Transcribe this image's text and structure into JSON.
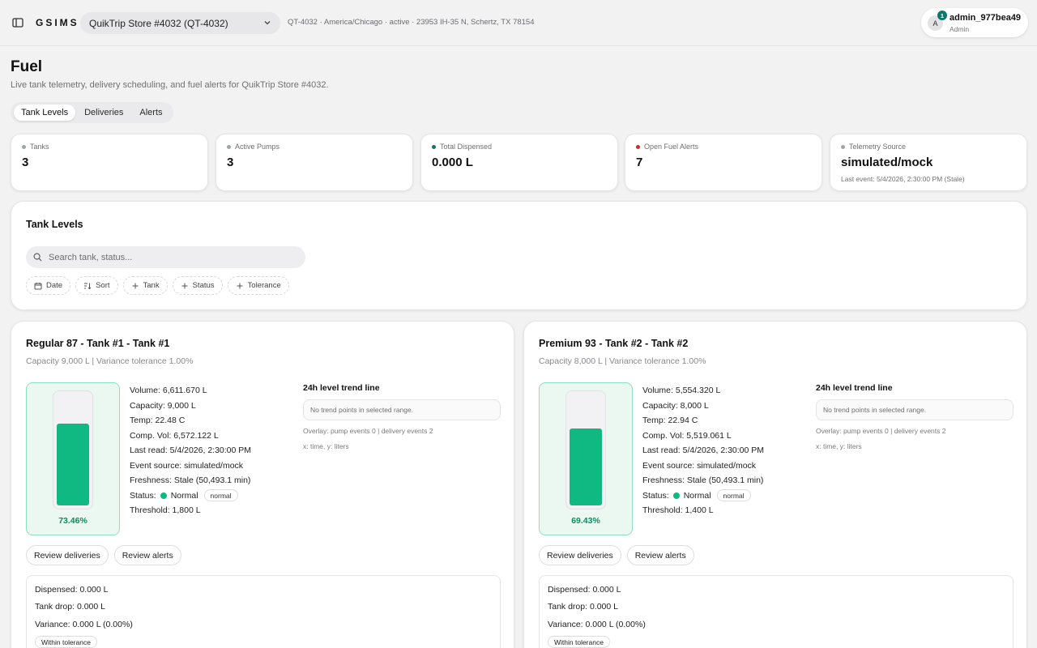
{
  "header": {
    "brand": "GSIMS",
    "store_select": "QuikTrip Store #4032 (QT-4032)",
    "store_meta": "QT-4032 · America/Chicago · active · 23953 IH-35 N, Schertz, TX 78154",
    "user": {
      "initial": "A",
      "badge": "1",
      "name": "admin_977bea49",
      "role": "Admin"
    }
  },
  "page": {
    "title": "Fuel",
    "subtitle": "Live tank telemetry, delivery scheduling, and fuel alerts for QuikTrip Store #4032."
  },
  "tabs": [
    "Tank Levels",
    "Deliveries",
    "Alerts"
  ],
  "stats": [
    {
      "label": "Tanks",
      "value": "3",
      "dot_color": "#9ca3af",
      "sub": ""
    },
    {
      "label": "Active Pumps",
      "value": "3",
      "dot_color": "#9ca3af",
      "sub": ""
    },
    {
      "label": "Total Dispensed",
      "value": "0.000 L",
      "dot_color": "#0f766e",
      "sub": ""
    },
    {
      "label": "Open Fuel Alerts",
      "value": "7",
      "dot_color": "#dc2626",
      "sub": ""
    },
    {
      "label": "Telemetry Source",
      "value": "simulated/mock",
      "dot_color": "#9ca3af",
      "sub": "Last event: 5/4/2026, 2:30:00 PM (Stale)"
    }
  ],
  "filter_panel": {
    "title": "Tank Levels",
    "search_placeholder": "Search tank, status...",
    "chips": [
      "Date",
      "Sort",
      "Tank",
      "Status",
      "Tolerance"
    ]
  },
  "tanks": [
    {
      "title": "Regular 87 - Tank #1 - Tank #1",
      "subtitle": "Capacity 9,000 L | Variance tolerance 1.00%",
      "fill_percent": 73.46,
      "fill_label": "73.46%",
      "readings": {
        "volume": "Volume: 6,611.670 L",
        "capacity": "Capacity: 9,000 L",
        "temp": "Temp: 22.48 C",
        "comp_vol": "Comp. Vol: 6,572.122 L",
        "last_read": "Last read: 5/4/2026, 2:30:00 PM",
        "event_source": "Event source: simulated/mock",
        "freshness": "Freshness: Stale (50,493.1 min)",
        "status_label": "Status:",
        "status_value": "Normal",
        "status_badge": "normal",
        "threshold": "Threshold: 1,800 L"
      },
      "trend": {
        "title": "24h level trend line",
        "empty": "No trend points in selected range.",
        "overlay": "Overlay: pump events 0 | delivery events 2",
        "axes": "x: time, y: liters"
      },
      "actions": [
        "Review deliveries",
        "Review alerts"
      ],
      "summary": {
        "dispensed": "Dispensed: 0.000 L",
        "tank_drop": "Tank drop: 0.000 L",
        "variance": "Variance: 0.000 L (0.00%)",
        "badge": "Within tolerance"
      }
    },
    {
      "title": "Premium 93 - Tank #2 - Tank #2",
      "subtitle": "Capacity 8,000 L | Variance tolerance 1.00%",
      "fill_percent": 69.43,
      "fill_label": "69.43%",
      "readings": {
        "volume": "Volume: 5,554.320 L",
        "capacity": "Capacity: 8,000 L",
        "temp": "Temp: 22.94 C",
        "comp_vol": "Comp. Vol: 5,519.061 L",
        "last_read": "Last read: 5/4/2026, 2:30:00 PM",
        "event_source": "Event source: simulated/mock",
        "freshness": "Freshness: Stale (50,493.1 min)",
        "status_label": "Status:",
        "status_value": "Normal",
        "status_badge": "normal",
        "threshold": "Threshold: 1,400 L"
      },
      "trend": {
        "title": "24h level trend line",
        "empty": "No trend points in selected range.",
        "overlay": "Overlay: pump events 0 | delivery events 2",
        "axes": "x: time, y: liters"
      },
      "actions": [
        "Review deliveries",
        "Review alerts"
      ],
      "summary": {
        "dispensed": "Dispensed: 0.000 L",
        "tank_drop": "Tank drop: 0.000 L",
        "variance": "Variance: 0.000 L (0.00%)",
        "badge": "Within tolerance"
      }
    }
  ]
}
